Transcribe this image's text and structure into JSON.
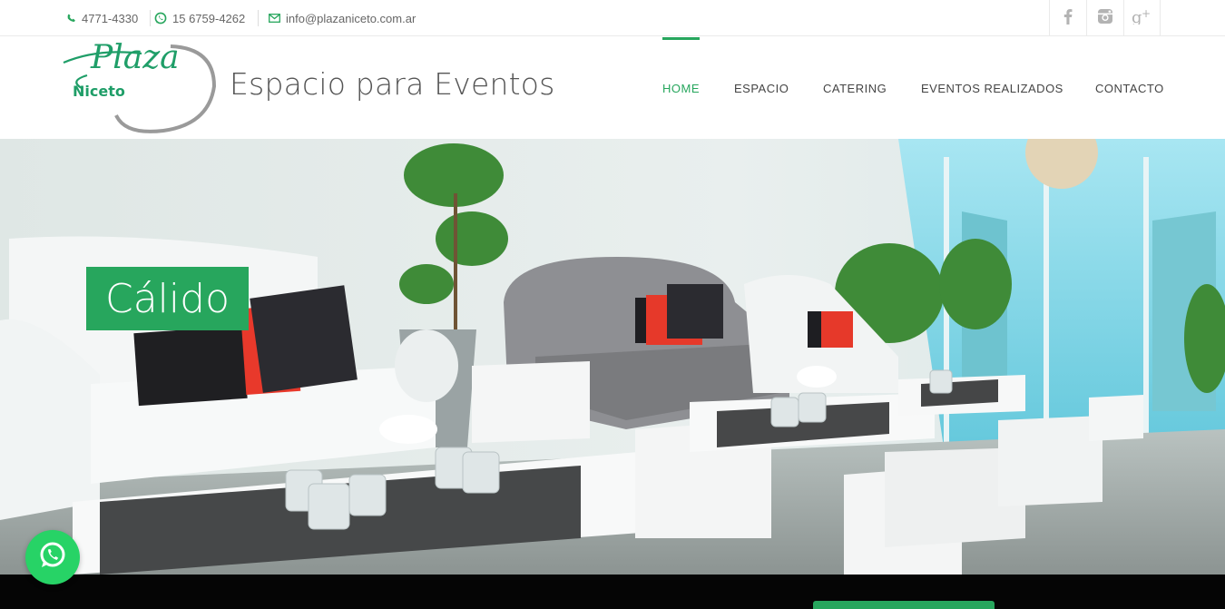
{
  "topbar": {
    "phone": "4771-4330",
    "whatsapp": "15 6759-4262",
    "email": "info@plazaniceto.com.ar",
    "social": [
      "facebook-icon",
      "instagram-icon",
      "google-plus-icon"
    ]
  },
  "header": {
    "logo_line1": "Plaza",
    "logo_line2": "Niceto",
    "tagline": "Espacio para Eventos"
  },
  "nav": {
    "items": [
      "HOME",
      "ESPACIO",
      "CATERING",
      "EVENTOS REALIZADOS",
      "CONTACTO"
    ],
    "active": "HOME"
  },
  "hero": {
    "caption": "Cálido"
  },
  "colors": {
    "accent": "#27a65d",
    "whatsapp": "#27d366",
    "bottom_strip": "#050505"
  }
}
